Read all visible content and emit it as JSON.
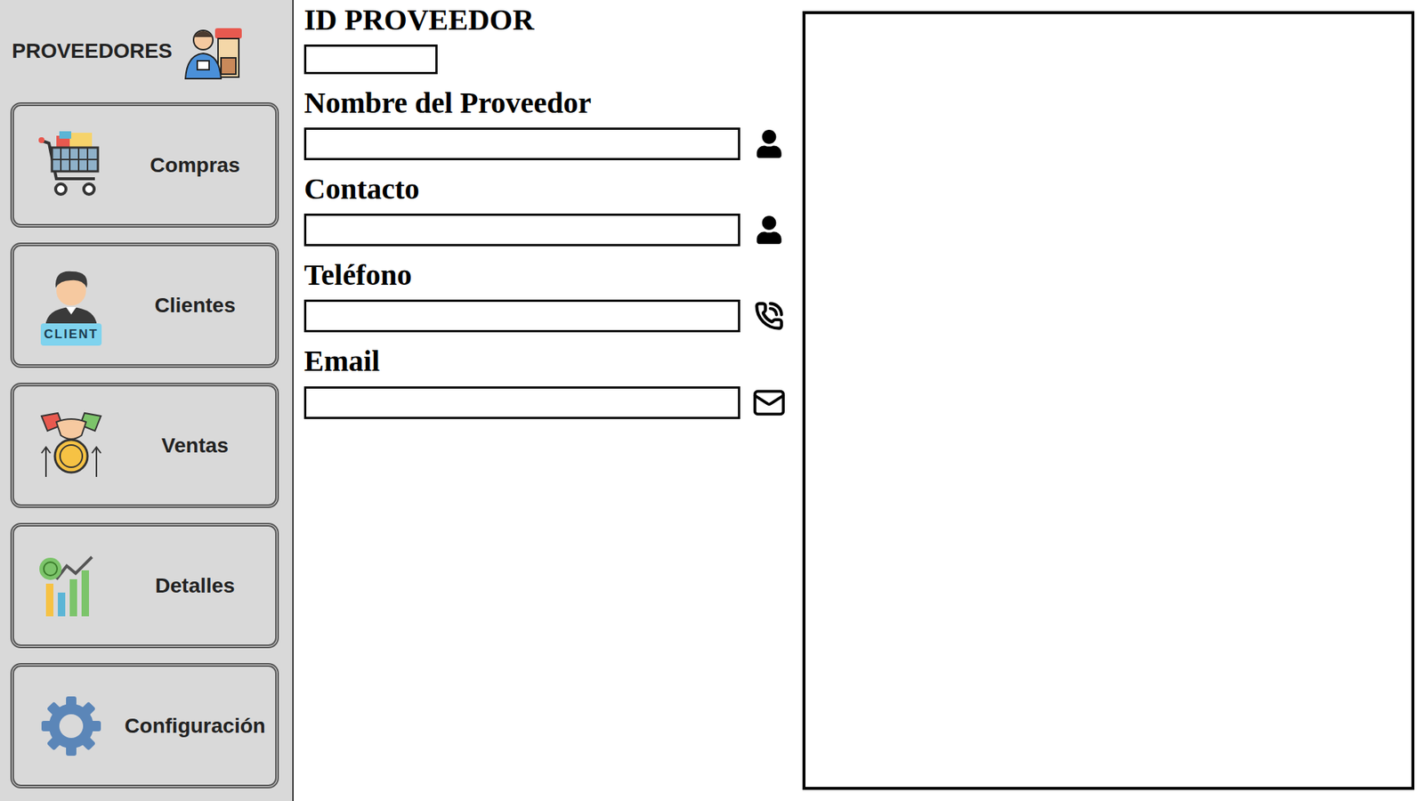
{
  "sidebar": {
    "title": "PROVEEDORES",
    "items": [
      {
        "label": "Compras"
      },
      {
        "label": "Clientes",
        "badge": "CLIENT"
      },
      {
        "label": "Ventas"
      },
      {
        "label": "Detalles"
      },
      {
        "label": "Configuración"
      }
    ]
  },
  "form": {
    "fields": [
      {
        "label": "ID PROVEEDOR",
        "value": "",
        "kind": "short"
      },
      {
        "label": "Nombre del Proveedor",
        "value": "",
        "kind": "person"
      },
      {
        "label": "Contacto",
        "value": "",
        "kind": "person"
      },
      {
        "label": "Teléfono",
        "value": "",
        "kind": "phone"
      },
      {
        "label": "Email",
        "value": "",
        "kind": "email"
      }
    ]
  },
  "panel": {
    "content": ""
  }
}
